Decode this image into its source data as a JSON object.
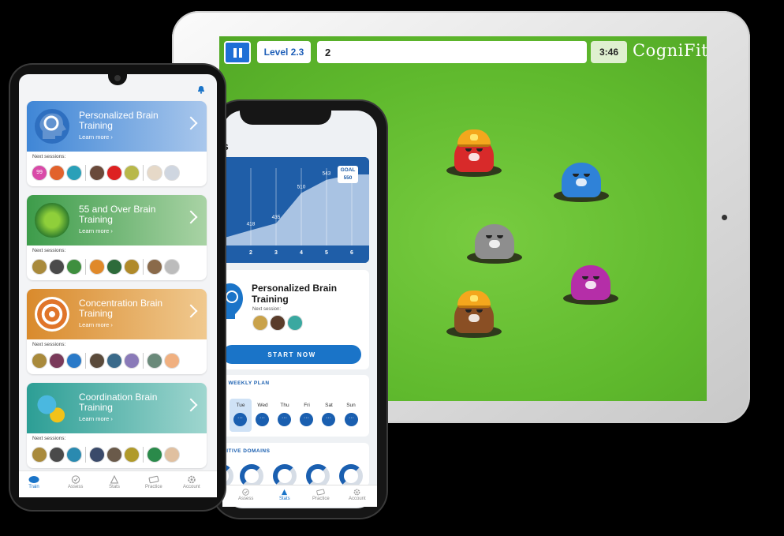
{
  "tablet": {
    "level_label": "Level 2.3",
    "score_value": "2",
    "timer": "3:46",
    "brand": "CogniFit"
  },
  "stats_phone": {
    "section_initial": "s",
    "chart_data": {
      "type": "area",
      "categories": [
        "",
        "2",
        "3",
        "4",
        "5",
        "6"
      ],
      "values": [
        null,
        418,
        435,
        510,
        543,
        null
      ],
      "goal": "550",
      "goal_label": "GOAL"
    },
    "card": {
      "title": "Personalized Brain Training",
      "next_session_label": "Next session:",
      "start_label": "START NOW"
    },
    "weekly_plan_title": "R WEEKLY PLAN",
    "days": [
      "Tue",
      "Wed",
      "Thu",
      "Fri",
      "Sat",
      "Sun"
    ],
    "day_dot": "···",
    "domains_title": "NITIVE DOMAINS",
    "nav": [
      "Assess",
      "Stats",
      "Practice",
      "Account"
    ]
  },
  "train_phone": {
    "cards": [
      {
        "title": "Personalized Brain Training",
        "learn_more": "Learn more ›",
        "next_sessions": "Next sessions:",
        "color_from": "#3f86d6",
        "color_to": "#a9c7ec",
        "first_thumb_text": "99"
      },
      {
        "title": "55 and Over Brain Training",
        "learn_more": "Learn more ›",
        "next_sessions": "Next sessions:",
        "color_from": "#3d9c4a",
        "color_to": "#a9d3a5"
      },
      {
        "title": "Concentration Brain Training",
        "learn_more": "Learn more ›",
        "next_sessions": "Next sessions:",
        "color_from": "#d98a2c",
        "color_to": "#f0c98f"
      },
      {
        "title": "Coordination Brain Training",
        "learn_more": "Learn more ›",
        "next_sessions": "Next sessions:",
        "color_from": "#2c9e95",
        "color_to": "#9fd6cf"
      }
    ],
    "nav": [
      "Train",
      "Assess",
      "Stats",
      "Practice",
      "Account"
    ],
    "active_nav": "Train"
  },
  "colors": {
    "accent": "#1a74c8",
    "grass": "#5fb92d"
  }
}
